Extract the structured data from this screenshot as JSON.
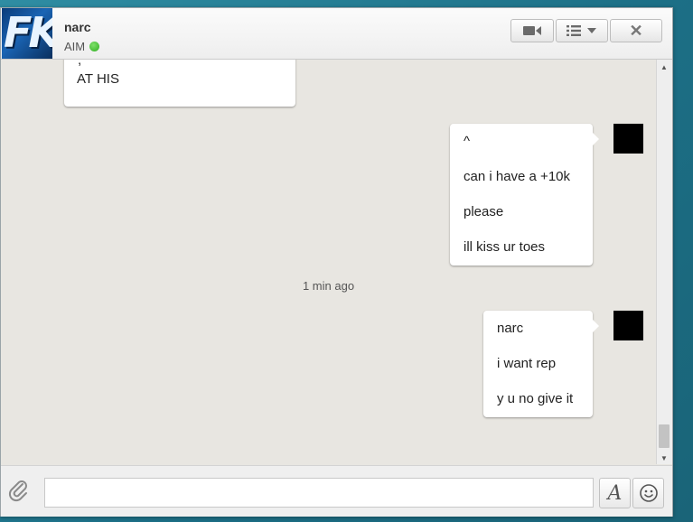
{
  "header": {
    "avatar_text": "FK",
    "contact_name": "narc",
    "service": "AIM",
    "status_color": "#3fbf2c",
    "video_icon": "video-camera-icon",
    "menu_icon": "list-dropdown-icon",
    "close_glyph": "✕"
  },
  "conversation": {
    "left_message": {
      "partial_line": ";",
      "line": "AT HIS"
    },
    "right_group_1": [
      "^",
      "can i have a +10k",
      "please",
      "ill kiss ur toes"
    ],
    "timestamp": "1 min ago",
    "right_group_2": [
      "narc",
      "i want rep",
      "y u no give it"
    ]
  },
  "composer": {
    "input_value": "",
    "font_button_glyph": "A",
    "emoji_glyph": "☺"
  }
}
